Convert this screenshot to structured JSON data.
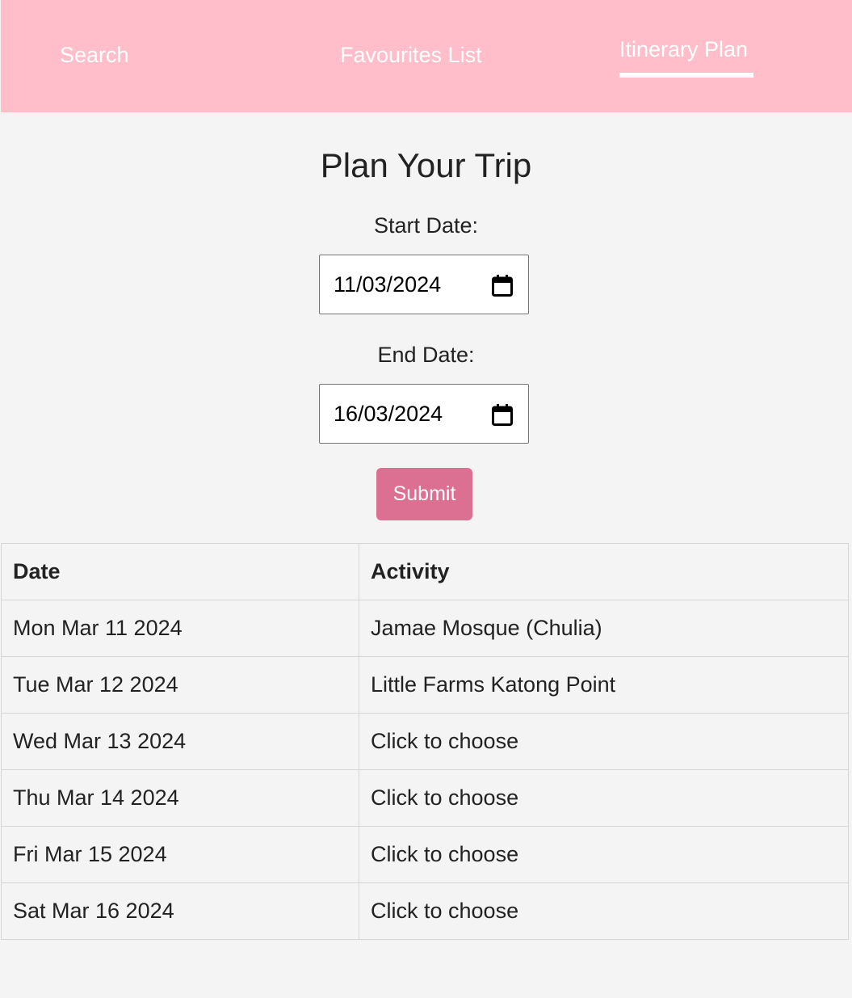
{
  "nav": {
    "items": [
      {
        "label": "Search"
      },
      {
        "label": "Favourites List"
      },
      {
        "label": "Itinerary Plan",
        "active": true
      }
    ]
  },
  "main": {
    "title": "Plan Your Trip",
    "start_label": "Start Date:",
    "start_value": "11/03/2024",
    "end_label": "End Date:",
    "end_value": "16/03/2024",
    "submit_label": "Submit"
  },
  "table": {
    "headers": [
      "Date",
      "Activity"
    ],
    "rows": [
      {
        "date": "Mon Mar 11 2024",
        "activity": "Jamae Mosque (Chulia)"
      },
      {
        "date": "Tue Mar 12 2024",
        "activity": "Little Farms Katong Point"
      },
      {
        "date": "Wed Mar 13 2024",
        "activity": "Click to choose"
      },
      {
        "date": "Thu Mar 14 2024",
        "activity": "Click to choose"
      },
      {
        "date": "Fri Mar 15 2024",
        "activity": "Click to choose"
      },
      {
        "date": "Sat Mar 16 2024",
        "activity": "Click to choose"
      }
    ]
  },
  "colors": {
    "navbar": "#ffbec9",
    "accent": "#db7093",
    "page_background": "#f4f4f4"
  },
  "icons": {
    "date_picker": "calendar-icon"
  }
}
